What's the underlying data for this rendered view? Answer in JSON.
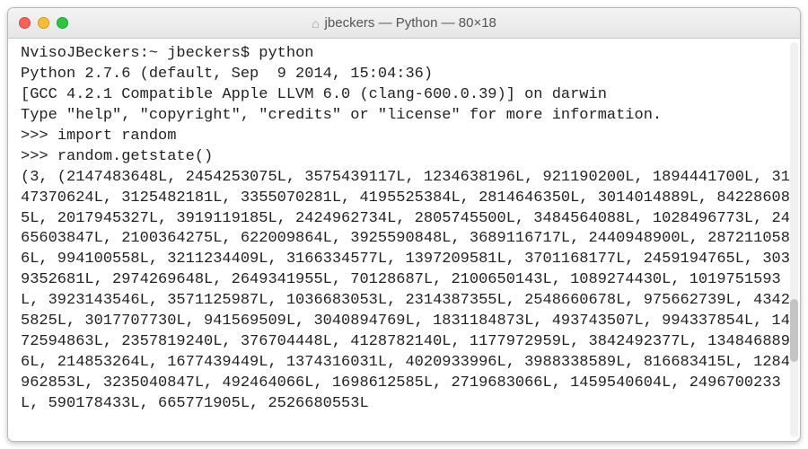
{
  "titlebar": {
    "home_icon": "⌂",
    "title": "jbeckers — Python — 80×18"
  },
  "terminal": {
    "prompt_host": "NvisoJBeckers:~",
    "prompt_user": "jbeckers$",
    "cmd1": "python",
    "py_line1": "Python 2.7.6 (default, Sep  9 2014, 15:04:36)",
    "py_line2": "[GCC 4.2.1 Compatible Apple LLVM 6.0 (clang-600.0.39)] on darwin",
    "py_line3": "Type \"help\", \"copyright\", \"credits\" or \"license\" for more information.",
    "repl_prefix": ">>>",
    "cmd2": "import random",
    "cmd3": "random.getstate()",
    "state_output": "(3, (2147483648L, 2454253075L, 3575439117L, 1234638196L, 921190200L, 1894441700L, 3147370624L, 3125482181L, 3355070281L, 4195525384L, 2814646350L, 3014014889L, 842286085L, 2017945327L, 3919119185L, 2424962734L, 2805745500L, 3484564088L, 1028496773L, 2465603847L, 2100364275L, 622009864L, 3925590848L, 3689116717L, 2440948900L, 2872110586L, 994100558L, 3211234409L, 3166334577L, 1397209581L, 3701168177L, 2459194765L, 3039352681L, 2974269648L, 2649341955L, 70128687L, 2100650143L, 1089274430L, 1019751593L, 3923143546L, 3571125987L, 1036683053L, 2314387355L, 2548660678L, 975662739L, 43425825L, 3017707730L, 941569509L, 3040894769L, 1831184873L, 493743507L, 994337854L, 1472594863L, 2357819240L, 376704448L, 4128782140L, 1177972959L, 3842492377L, 1348468896L, 214853264L, 1677439449L, 1374316031L, 4020933996L, 3988338589L, 816683415L, 1284962853L, 3235040847L, 492464066L, 1698612585L, 2719683066L, 1459540604L, 2496700233L, 590178433L, 665771905L, 2526680553L"
  }
}
